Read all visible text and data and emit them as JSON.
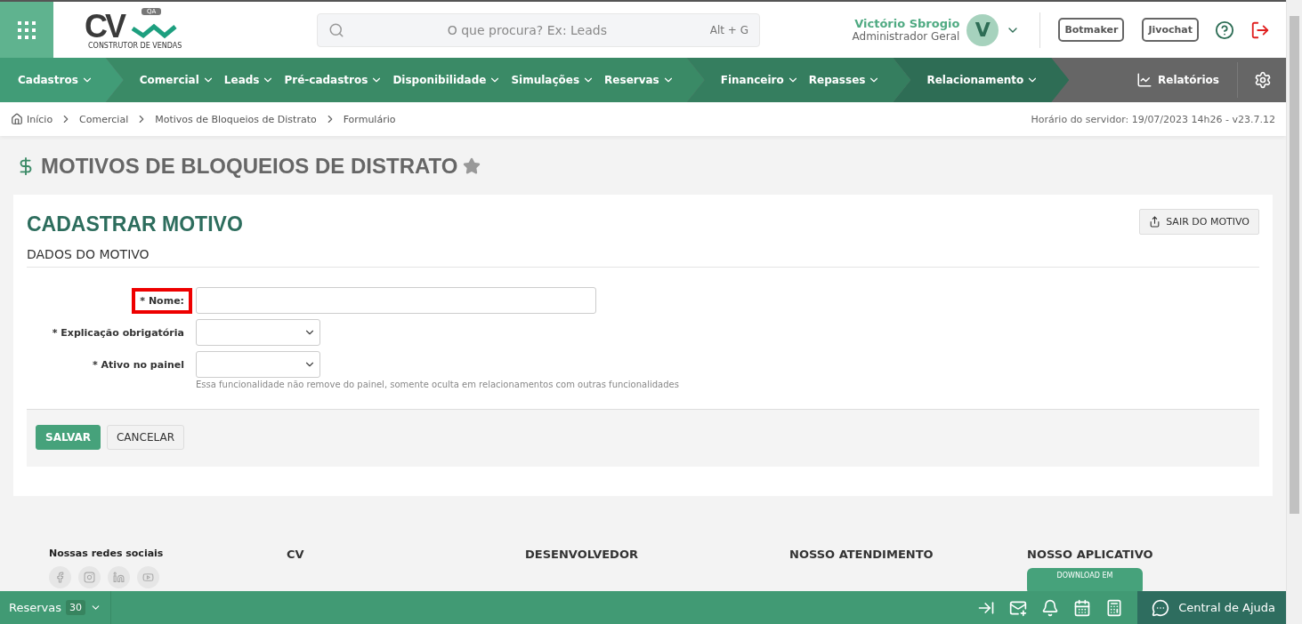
{
  "header": {
    "logo": {
      "text": "CV",
      "badge": "QA",
      "tagline": "CONSTRUTOR DE VENDAS"
    },
    "search": {
      "placeholder": "O que procura? Ex: Leads",
      "shortcut": "Alt + G"
    },
    "user": {
      "name": "Victório Sbrogio",
      "role": "Administrador Geral",
      "initial": "V"
    },
    "buttons": [
      "Botmaker",
      "Jivochat"
    ]
  },
  "nav": {
    "groups": [
      {
        "color": "#419c77",
        "items": [
          "Cadastros"
        ]
      },
      {
        "color": "#3a8a66",
        "items": [
          "Comercial",
          "Leads",
          "Pré-cadastros",
          "Disponibilidade",
          "Simulações",
          "Reservas"
        ]
      },
      {
        "color": "#357e5f",
        "items": [
          "Financeiro",
          "Repasses"
        ]
      },
      {
        "color": "#2e6d55",
        "items": [
          "Relacionamento"
        ]
      }
    ],
    "reports": "Relatórios"
  },
  "breadcrumb": [
    "Início",
    "Comercial",
    "Motivos de Bloqueios de Distrato",
    "Formulário"
  ],
  "server_time": "Horário do servidor: 19/07/2023 14h26 - v23.7.12",
  "page_title": "MOTIVOS DE BLOQUEIOS DE DISTRATO",
  "favorite": false,
  "form": {
    "title": "CADASTRAR MOTIVO",
    "exit_button": "SAIR DO MOTIVO",
    "section": "DADOS DO MOTIVO",
    "fields": [
      {
        "kind": "text",
        "label": "* Nome:",
        "highlighted": true
      },
      {
        "kind": "select",
        "label": "* Explicação obrigatória",
        "highlighted": false
      },
      {
        "kind": "select",
        "label": "* Ativo no painel",
        "highlighted": false,
        "hint": "Essa funcionalidade não remove do painel, somente oculta em relacionamentos com outras funcionalidades"
      }
    ],
    "buttons": [
      {
        "kind": "primary",
        "label": "SALVAR"
      },
      {
        "kind": "secondary",
        "label": "CANCELAR"
      }
    ]
  },
  "footer": {
    "social_title": "Nossas redes sociais",
    "columns": [
      "CV",
      "DESENVOLVEDOR",
      "NOSSO ATENDIMENTO",
      "NOSSO APLICATIVO"
    ],
    "app_badge": "DOWNLOAD EM"
  },
  "bottom_bar": {
    "reservas": {
      "label": "Reservas",
      "count": "30"
    },
    "help": "Central de Ajuda"
  }
}
